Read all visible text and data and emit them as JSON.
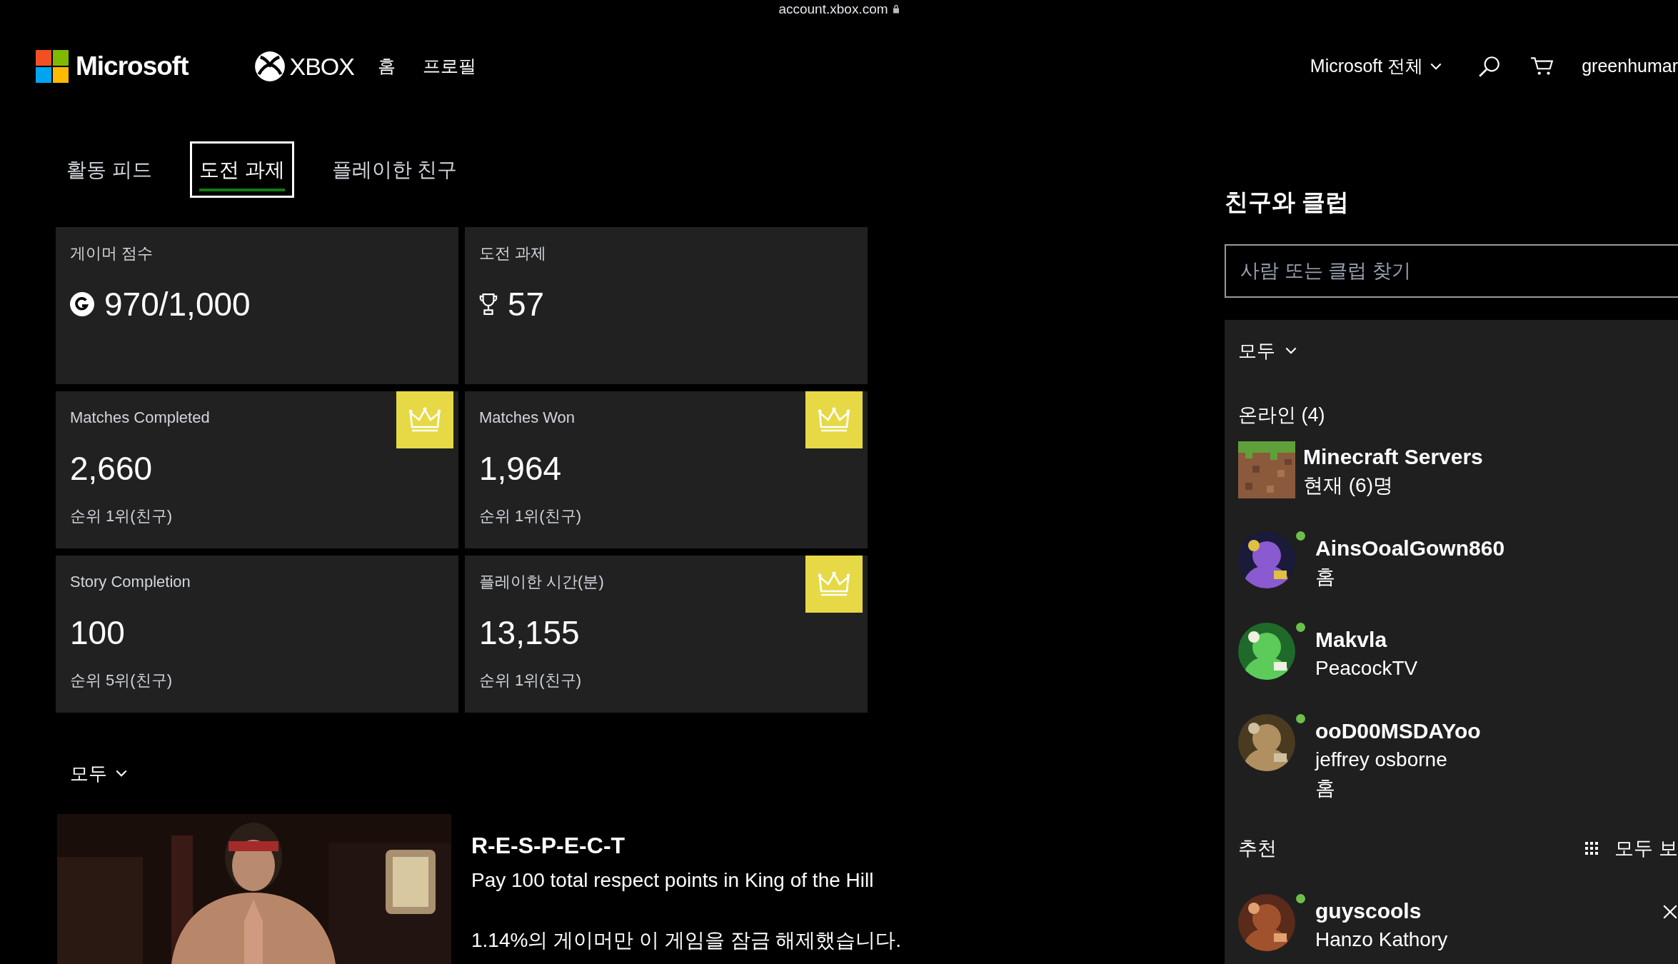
{
  "address_bar": {
    "url": "account.xbox.com"
  },
  "nav": {
    "brand": "Microsoft",
    "product": "XBOX",
    "links": [
      "홈",
      "프로필"
    ],
    "all_menu": "Microsoft 전체",
    "user": "greenhumar"
  },
  "tabs": [
    {
      "label": "활동 피드",
      "selected": false
    },
    {
      "label": "도전 과제",
      "selected": true
    },
    {
      "label": "플레이한 친구",
      "selected": false
    }
  ],
  "stats": [
    {
      "kind": "score",
      "label": "게이머 점수",
      "value": "970/1,000",
      "crowned": false
    },
    {
      "kind": "count",
      "label": "도전 과제",
      "value": "57",
      "crowned": false
    },
    {
      "kind": "stat",
      "label": "Matches Completed",
      "value": "2,660",
      "rank": "순위 1위(친구)",
      "crowned": true
    },
    {
      "kind": "stat",
      "label": "Matches Won",
      "value": "1,964",
      "rank": "순위 1위(친구)",
      "crowned": true
    },
    {
      "kind": "stat",
      "label": "Story Completion",
      "value": "100",
      "rank": "순위 5위(친구)",
      "crowned": false
    },
    {
      "kind": "stat",
      "label": "플레이한 시간(분)",
      "value": "13,155",
      "rank": "순위 1위(친구)",
      "crowned": true
    }
  ],
  "filter": "모두",
  "achievement": {
    "title": "R-E-S-P-E-C-T",
    "description": "Pay 100 total respect points in King of the Hill",
    "rarity": "1.14%의 게이머만 이 게임을 잠금 해제했습니다."
  },
  "friends_panel": {
    "title": "친구와 클럽",
    "search": {
      "placeholder": "사람 또는 클럽 찾기"
    },
    "filter": "모두",
    "online_heading": "온라인 (4)",
    "online": [
      {
        "kind": "club",
        "name": "Minecraft Servers",
        "lines": [
          "현재 (6)명"
        ]
      },
      {
        "kind": "person",
        "name": "AinsOoalGown860",
        "lines": [
          "홈"
        ],
        "online": true
      },
      {
        "kind": "person",
        "name": "Makvla",
        "lines": [
          "PeacockTV"
        ],
        "online": true
      },
      {
        "kind": "person",
        "name": "ooD00MSDAYoo",
        "lines": [
          "jeffrey osborne",
          "홈"
        ],
        "online": true
      }
    ],
    "suggested_heading": "추천",
    "see_all": "모두 보",
    "suggested": [
      {
        "kind": "person",
        "name": "guyscools",
        "lines": [
          "Hanzo Kathory"
        ],
        "online": true
      }
    ]
  }
}
